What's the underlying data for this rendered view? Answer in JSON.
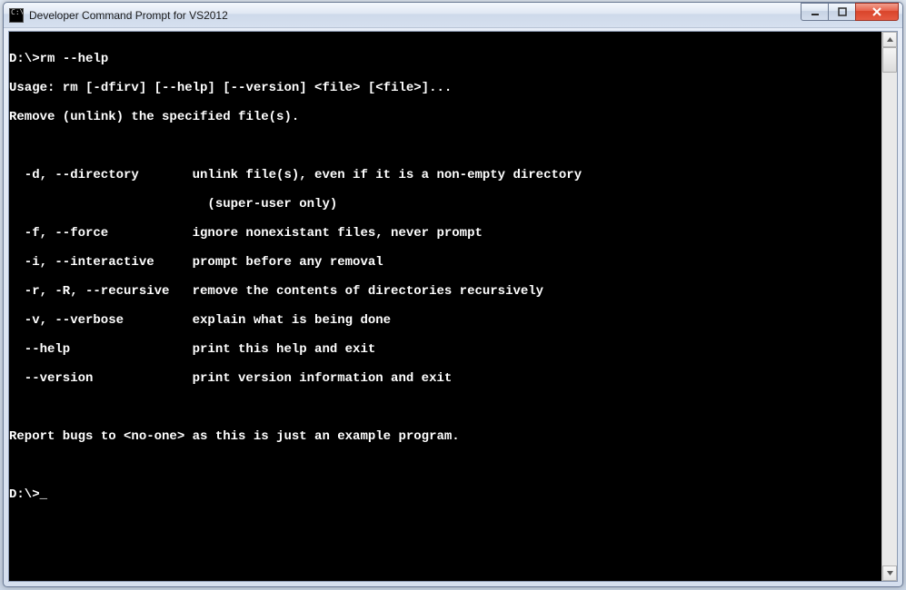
{
  "window": {
    "title": "Developer Command Prompt for VS2012",
    "icon_label": "cmd-icon",
    "controls": {
      "minimize": "Minimize",
      "maximize": "Maximize",
      "close": "Close"
    }
  },
  "terminal": {
    "prompt1": "D:\\>",
    "command1": "rm --help",
    "usage": "Usage: rm [-dfirv] [--help] [--version] <file> [<file>]...",
    "desc": "Remove (unlink) the specified file(s).",
    "options": [
      {
        "flag": "-d, --directory",
        "text": "unlink file(s), even if it is a non-empty directory",
        "cont": "(super-user only)"
      },
      {
        "flag": "-f, --force",
        "text": "ignore nonexistant files, never prompt"
      },
      {
        "flag": "-i, --interactive",
        "text": "prompt before any removal"
      },
      {
        "flag": "-r, -R, --recursive",
        "text": "remove the contents of directories recursively"
      },
      {
        "flag": "-v, --verbose",
        "text": "explain what is being done"
      },
      {
        "flag": "--help",
        "text": "print this help and exit"
      },
      {
        "flag": "--version",
        "text": "print version information and exit"
      }
    ],
    "footer": "Report bugs to <no-one> as this is just an example program.",
    "prompt2": "D:\\>"
  },
  "icons": {
    "cmd_glyph": "C:\\"
  }
}
